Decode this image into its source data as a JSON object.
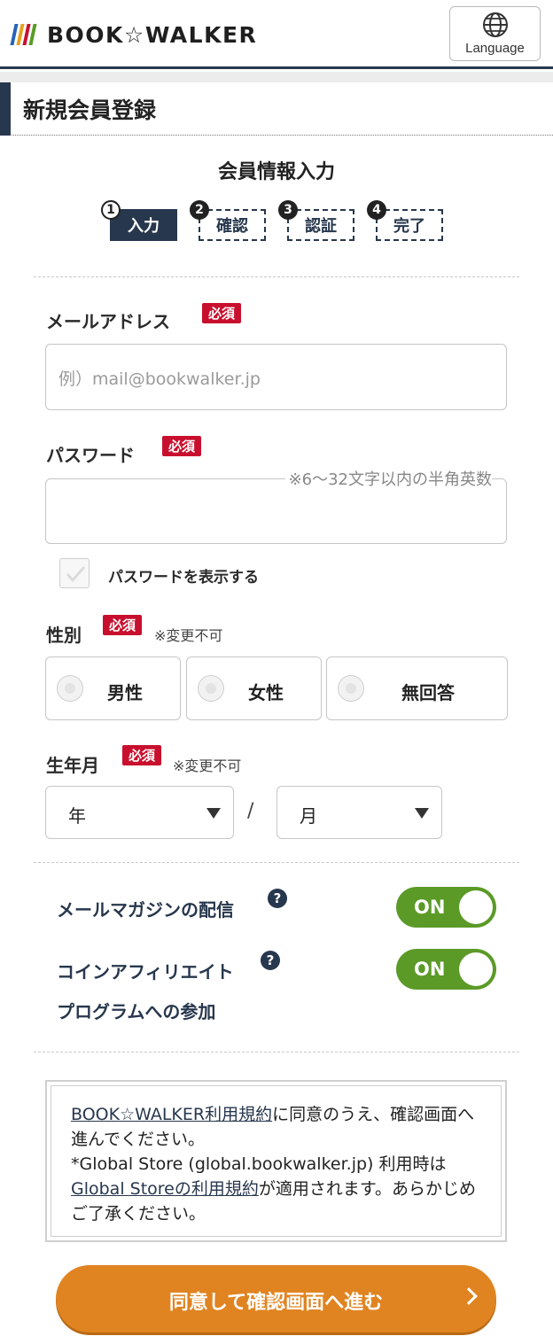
{
  "header": {
    "logo_text": "BOOK☆WALKER",
    "logo_colors": [
      "#2a62b8",
      "#e6a01e",
      "#c8102e",
      "#5b9a27",
      "#7a3fa0"
    ],
    "language_label": "Language"
  },
  "page_title": "新規会員登録",
  "section_title": "会員情報入力",
  "steps": [
    {
      "num": "1",
      "label": "入力",
      "active": true
    },
    {
      "num": "2",
      "label": "確認",
      "active": false
    },
    {
      "num": "3",
      "label": "認証",
      "active": false
    },
    {
      "num": "4",
      "label": "完了",
      "active": false
    }
  ],
  "required_badge": "必須",
  "email": {
    "label": "メールアドレス",
    "placeholder": "例）mail@bookwalker.jp",
    "value": ""
  },
  "password": {
    "label": "パスワード",
    "hint": "※6〜32文字以内の半角英数",
    "value": ""
  },
  "show_password": {
    "label": "パスワードを表示する",
    "checked": false
  },
  "gender": {
    "label": "性別",
    "note": "※変更不可",
    "options": [
      "男性",
      "女性",
      "無回答"
    ],
    "selected": null
  },
  "birth": {
    "label": "生年月",
    "note": "※変更不可",
    "year_value": "年",
    "separator": "/",
    "month_value": "月"
  },
  "mail_magazine": {
    "label": "メールマガジンの配信",
    "help": "?",
    "toggle": "ON"
  },
  "coin_affiliate": {
    "label_line1": "コインアフィリエイト",
    "label_line2": "プログラムへの参加",
    "help": "?",
    "toggle": "ON"
  },
  "terms": {
    "link1": "BOOK☆WALKER利用規約",
    "text1": "に同意のうえ、確認画面へ進んでください。",
    "text2": "*Global Store (global.bookwalker.jp) 利用時は",
    "link2": "Global Storeの利用規約",
    "text3": "が適用されます。あらかじめご了承ください。"
  },
  "submit_label": "同意して確認画面へ進む"
}
